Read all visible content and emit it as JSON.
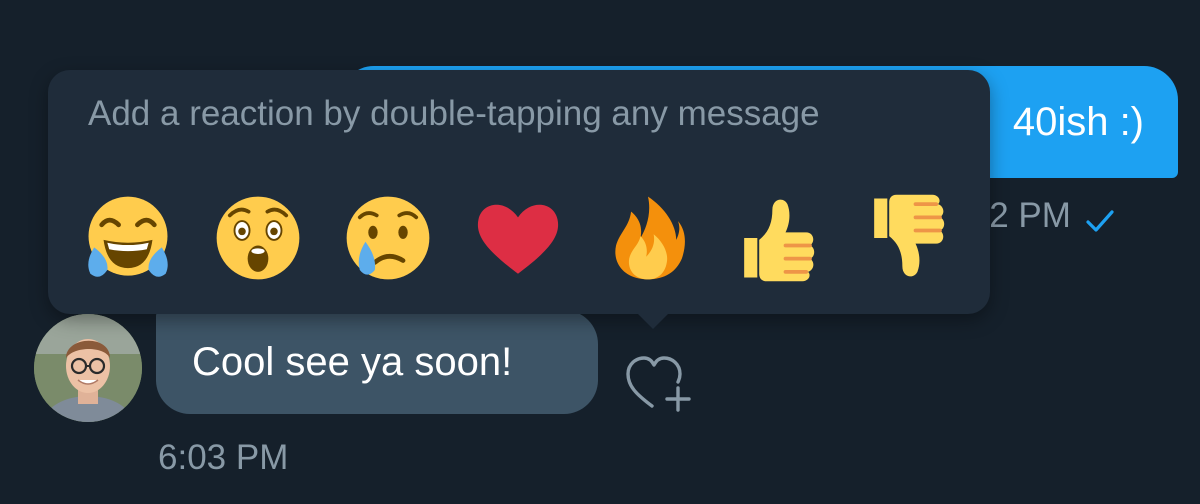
{
  "conversation": {
    "outgoing": {
      "text": "40ish :)",
      "time": ":02 PM",
      "status_icon": "check-icon"
    },
    "incoming": {
      "text": "Cool see ya soon!",
      "time": "6:03 PM",
      "avatar_icon": "avatar"
    }
  },
  "reaction_popup": {
    "hint": "Add a reaction by double-tapping any message",
    "reactions": [
      {
        "name": "tears-of-joy-icon"
      },
      {
        "name": "surprised-icon"
      },
      {
        "name": "crying-icon"
      },
      {
        "name": "heart-icon"
      },
      {
        "name": "fire-icon"
      },
      {
        "name": "thumbs-up-icon"
      },
      {
        "name": "thumbs-down-icon"
      }
    ]
  },
  "add_reaction_button": {
    "icon": "heart-plus-icon"
  },
  "colors": {
    "background": "#15202b",
    "outgoing_bubble": "#1da1f2",
    "incoming_bubble": "#3d5466",
    "popup": "#1f2c3a",
    "secondary_text": "#8899a6"
  }
}
